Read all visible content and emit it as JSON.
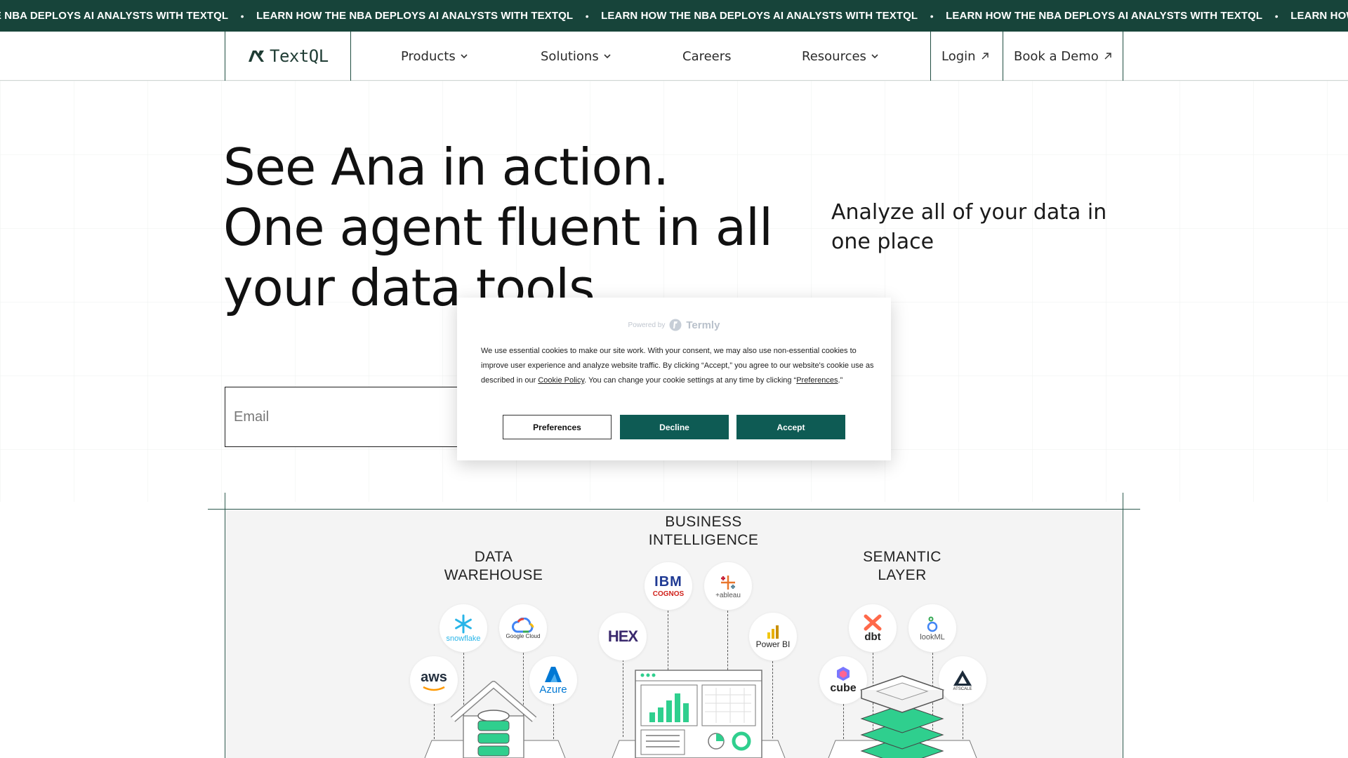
{
  "ticker": {
    "items": [
      "HE NBA DEPLOYS AI ANALYSTS WITH TEXTQL",
      "LEARN HOW THE NBA DEPLOYS AI ANALYSTS WITH TEXTQL",
      "LEARN HOW THE NBA DEPLOYS AI ANALYSTS WITH TEXTQL",
      "LEARN HOW THE NBA DEPLOYS AI ANALYSTS WITH TEXTQL",
      "LEARN HOW THE NBA DEPLOYS AI ANALYSTS WITH TEXTQL"
    ],
    "separator": "•",
    "background": "#17443a"
  },
  "header": {
    "logo_text": "TextQL",
    "nav": {
      "products": "Products",
      "solutions": "Solutions",
      "careers": "Careers",
      "resources": "Resources"
    },
    "login": "Login",
    "book_demo": "Book a Demo"
  },
  "hero": {
    "title_lines": [
      "See Ana in action.",
      "One agent fluent in all",
      "your data tools"
    ],
    "subtitle": "Analyze all of your data in one place",
    "email_placeholder": "Email"
  },
  "diagram": {
    "warehouse_label": [
      "DATA",
      "WAREHOUSE"
    ],
    "bi_label": [
      "BUSINESS",
      "INTELLIGENCE"
    ],
    "semantic_label": [
      "SEMANTIC",
      "LAYER"
    ],
    "warehouse_logos": [
      "snowflake",
      "Google Cloud",
      "aws",
      "Azure"
    ],
    "bi_logos": [
      "IBM",
      "COGNOS",
      "+ableau",
      "HEX",
      "Power BI"
    ],
    "semantic_logos": [
      "dbt",
      "lookML",
      "cube",
      "ATSCALE"
    ],
    "accent": "#2fcf8e"
  },
  "cookie": {
    "powered_by": "Powered by",
    "brand": "Termly",
    "text_1": "We use essential cookies to make our site work. With your consent, we may also use non-essential cookies to improve user experience and analyze website traffic. By clicking “Accept,” you agree to our website's cookie use as described in our ",
    "cookie_policy_link": "Cookie Policy",
    "text_2": ". You can change your cookie settings at any time by clicking “",
    "preferences_link": "Preferences",
    "text_3": ".”",
    "buttons": {
      "preferences": "Preferences",
      "decline": "Decline",
      "accept": "Accept"
    },
    "button_color": "#0e5b54"
  }
}
